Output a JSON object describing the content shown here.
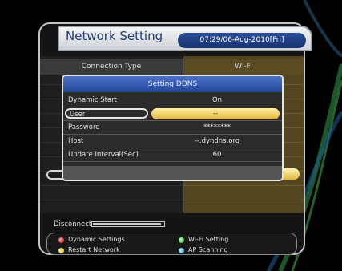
{
  "header": {
    "title": "Network Setting",
    "datetime": "07:29/06-Aug-2010[Fri]"
  },
  "columns": {
    "left": "Connection Type",
    "right": "Wi-Fi"
  },
  "dialog": {
    "title": "Setting DDNS",
    "rows": [
      {
        "label": "Dynamic Start",
        "value": "On"
      },
      {
        "label": "User",
        "value": "--"
      },
      {
        "label": "Password",
        "value": "********"
      },
      {
        "label": "Host",
        "value": "--.dyndns.org"
      },
      {
        "label": "Update Interval(Sec)",
        "value": "60"
      }
    ],
    "selected_index": 1
  },
  "status": {
    "disconnect_label": "Disconnect",
    "progress_fraction": 0.97
  },
  "legend": {
    "dynamic_settings": "Dynamic Settings",
    "restart_network": "Restart Network",
    "wifi_setting": "Wi-Fi Setting",
    "ap_scanning": "AP Scanning"
  },
  "colors": {
    "accent_blue": "#22469a",
    "highlight_gold": "#e3b43c",
    "red_key": "#d11818",
    "yellow_key": "#d9c018",
    "green_key": "#2cb02c",
    "blue_key": "#22a0d8"
  }
}
